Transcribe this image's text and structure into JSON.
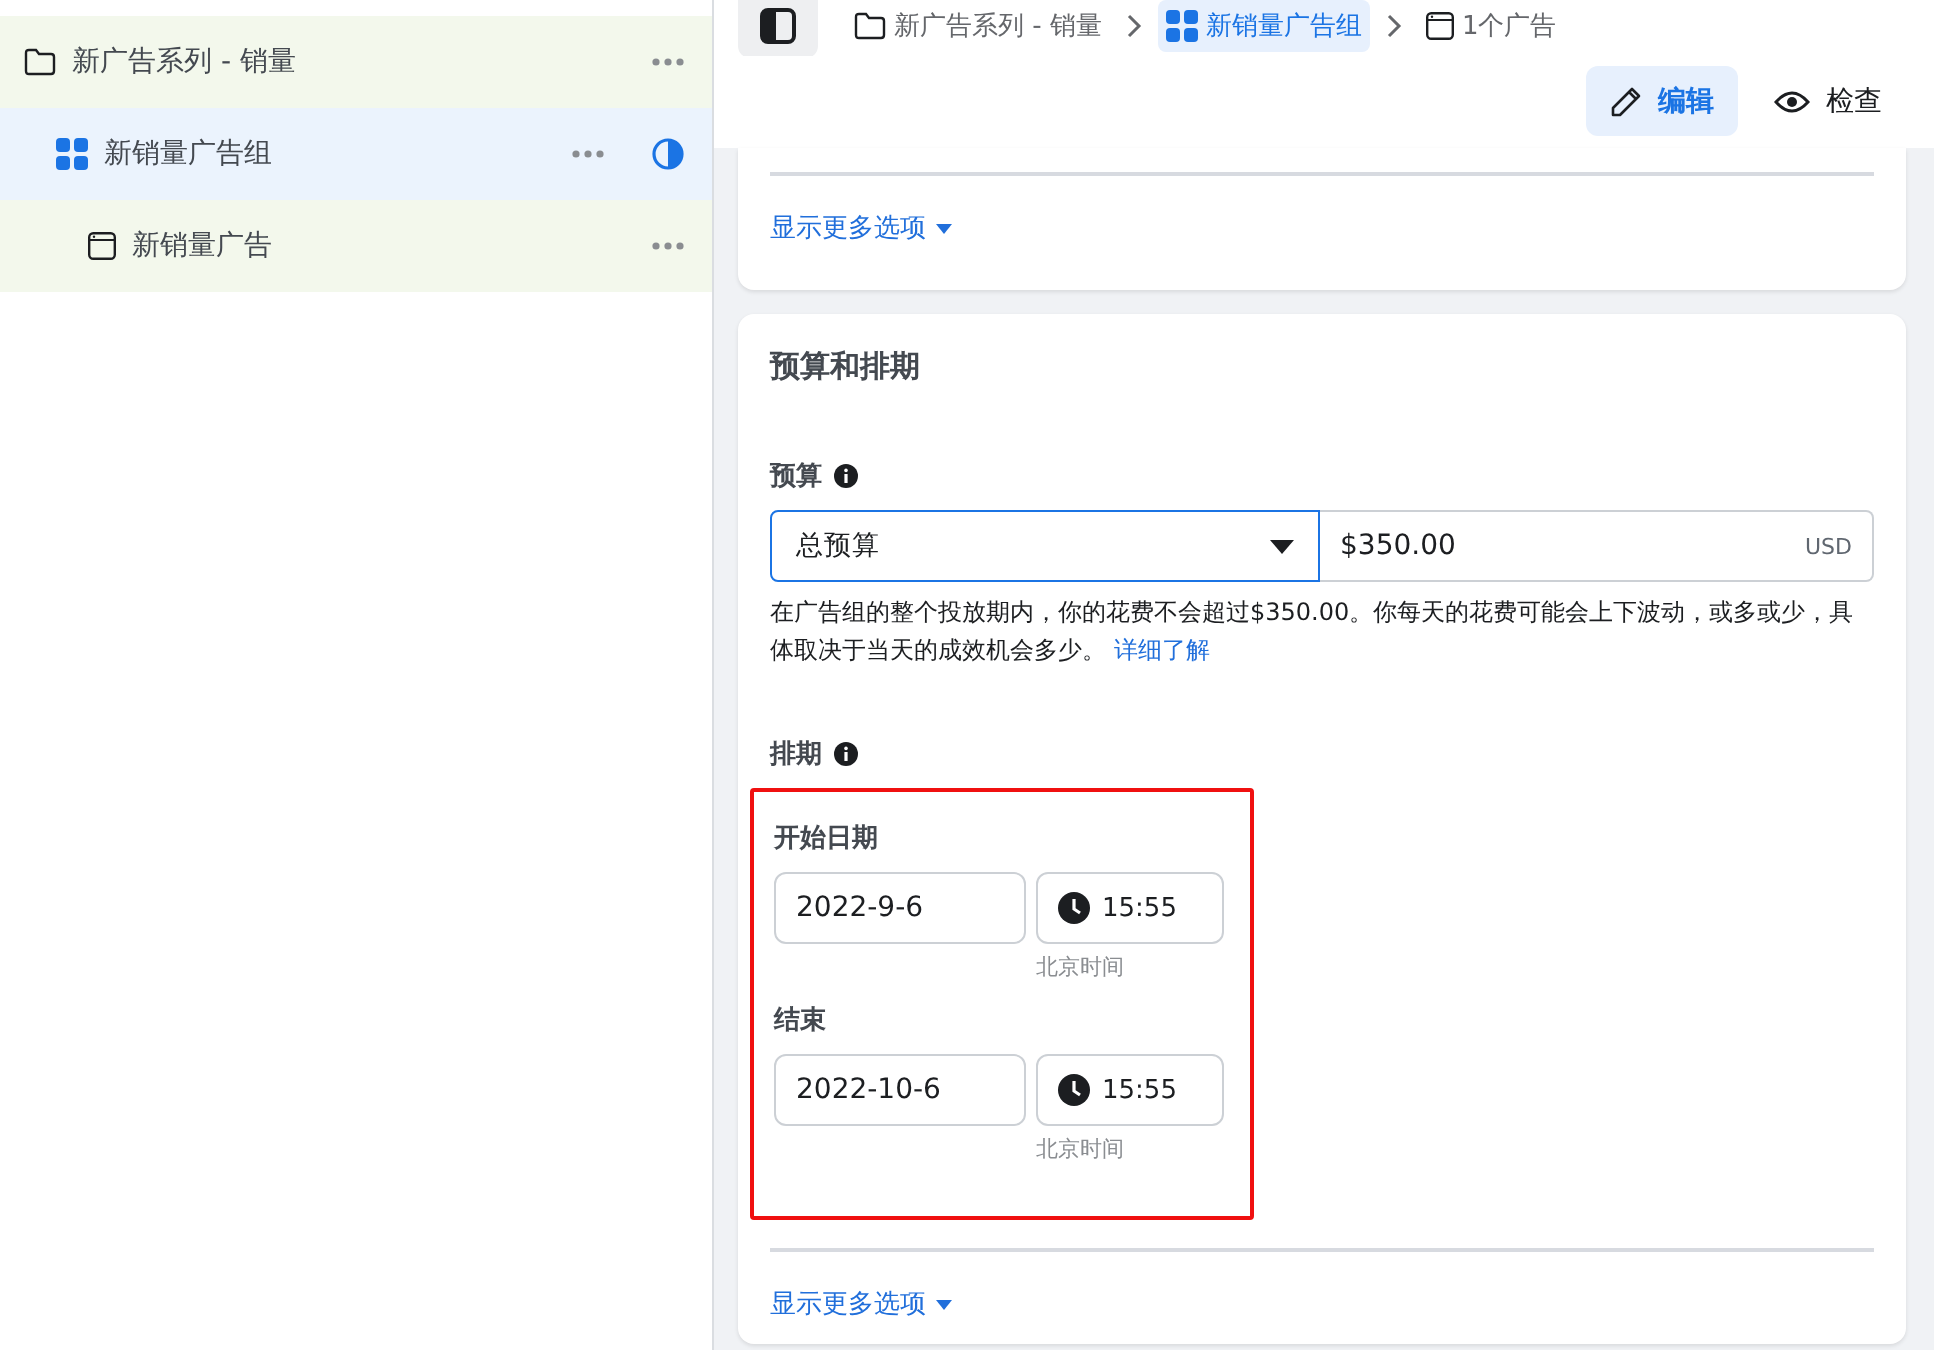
{
  "sidebar": {
    "items": [
      {
        "kind": "campaign",
        "label": "新广告系列 - 销量",
        "selected": false,
        "children": [
          {
            "kind": "adset",
            "label": "新销量广告组",
            "selected": true,
            "children": [
              {
                "kind": "ad",
                "label": "新销量广告",
                "selected": false
              }
            ]
          }
        ]
      }
    ]
  },
  "breadcrumb": [
    {
      "kind": "campaign",
      "label": "新广告系列 - 销量",
      "selected": false
    },
    {
      "kind": "adset",
      "label": "新销量广告组",
      "selected": true
    },
    {
      "kind": "ad",
      "label": "1个广告",
      "selected": false
    }
  ],
  "actions": [
    {
      "kind": "edit",
      "label": "编辑",
      "selected": true
    },
    {
      "kind": "inspect",
      "label": "检查",
      "selected": false
    }
  ],
  "top_card": {
    "more_options": "显示更多选项"
  },
  "budget_card": {
    "title": "预算和排期",
    "budget": {
      "label": "预算",
      "type": "总预算",
      "amount": "$350.00",
      "currency": "USD",
      "description": "在广告组的整个投放期内，你的花费不会超过$350.00。你每天的花费可能会上下波动，或多或少，具体取决于当天的成效机会多少。",
      "learn_more": "详细了解"
    },
    "schedule": {
      "label": "排期",
      "highlighted": true,
      "start": {
        "label": "开始日期",
        "date": "2022-9-6",
        "time": "15:55",
        "timezone": "北京时间"
      },
      "end": {
        "label": "结束",
        "date": "2022-10-6",
        "time": "15:55",
        "timezone": "北京时间"
      }
    },
    "more_options": "显示更多选项"
  }
}
